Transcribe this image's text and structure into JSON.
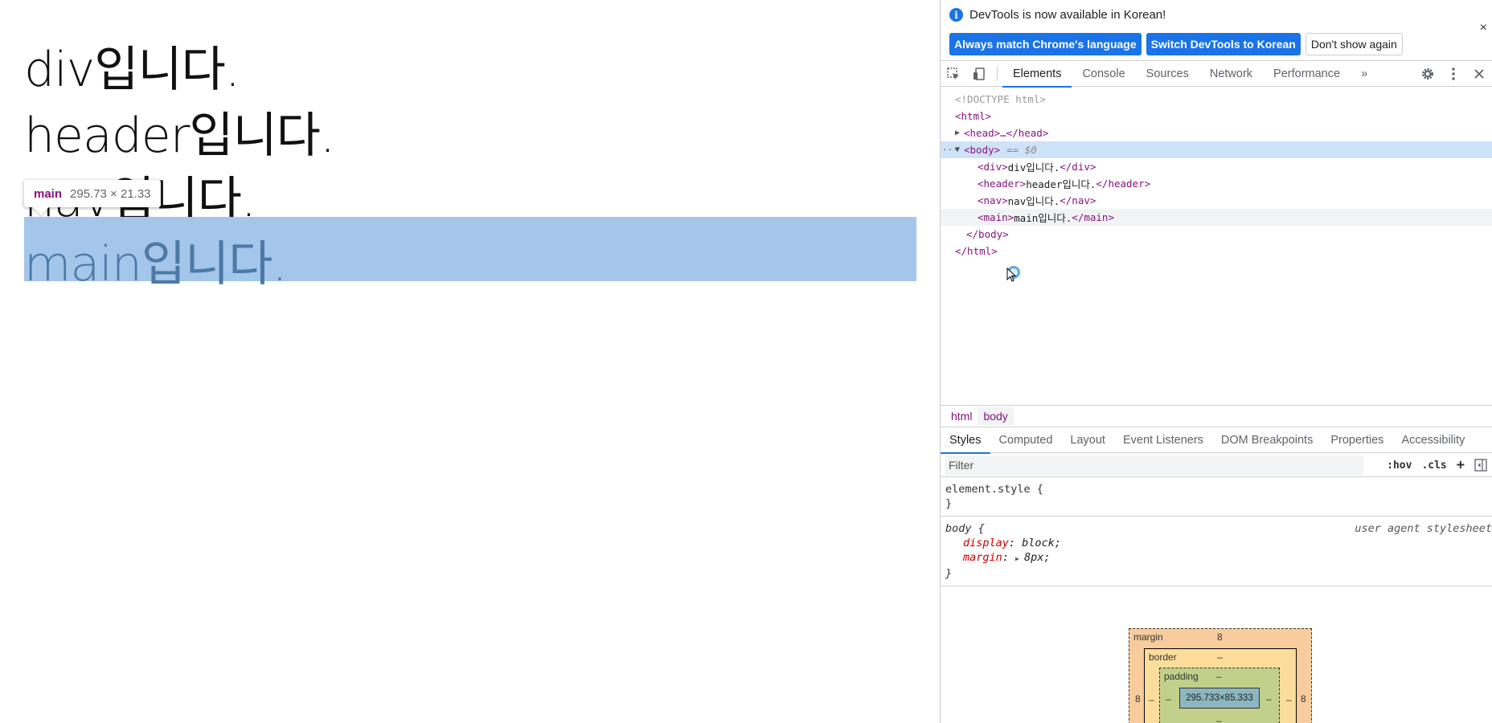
{
  "page": {
    "lines": [
      "div입니다.",
      "header입니다.",
      "nav입니다.",
      "main입니다."
    ],
    "tooltip": {
      "tag": "main",
      "dims": "295.73 × 21.33"
    }
  },
  "devtools": {
    "infobar": {
      "message": "DevTools is now available in Korean!",
      "buttons": [
        "Always match Chrome's language",
        "Switch DevTools to Korean"
      ],
      "dismiss": "Don't show again",
      "close": "×"
    },
    "tabs": [
      "Elements",
      "Console",
      "Sources",
      "Network",
      "Performance"
    ],
    "more_tabs": "»",
    "tree": {
      "doctype": "<!DOCTYPE html>",
      "html_open": "<html>",
      "head": "<head>…</head>",
      "body_open": "<body>",
      "body_marker": "== $0",
      "children": [
        {
          "open": "<div>",
          "text": "div입니다.",
          "close": "</div>"
        },
        {
          "open": "<header>",
          "text": "header입니다.",
          "close": "</header>"
        },
        {
          "open": "<nav>",
          "text": "nav입니다.",
          "close": "</nav>"
        },
        {
          "open": "<main>",
          "text": "main입니다.",
          "close": "</main>"
        }
      ],
      "body_close": "</body>",
      "html_close": "</html>",
      "dots": "···"
    },
    "breadcrumbs": [
      "html",
      "body"
    ],
    "subtabs": [
      "Styles",
      "Computed",
      "Layout",
      "Event Listeners",
      "DOM Breakpoints",
      "Properties",
      "Accessibility"
    ],
    "filter": {
      "placeholder": "Filter",
      "hov": ":hov",
      "cls": ".cls",
      "plus": "+"
    },
    "styles": {
      "element_style": {
        "selector": "element.style {",
        "close": "}"
      },
      "body_rule": {
        "selector": "body {",
        "source": "user agent stylesheet",
        "decls": [
          {
            "prop": "display",
            "value": "block;"
          },
          {
            "prop": "margin",
            "value": "8px;"
          }
        ],
        "close": "}"
      }
    },
    "boxmodel": {
      "margin_label": "margin",
      "margin_top": "8",
      "margin_left": "8",
      "margin_right": "8",
      "border_label": "border",
      "border_top": "–",
      "border_left": "–",
      "border_right": "–",
      "padding_label": "padding",
      "padding_top": "–",
      "padding_left": "–",
      "padding_right": "–",
      "padding_bottom": "–",
      "content": "295.733×85.333"
    }
  }
}
